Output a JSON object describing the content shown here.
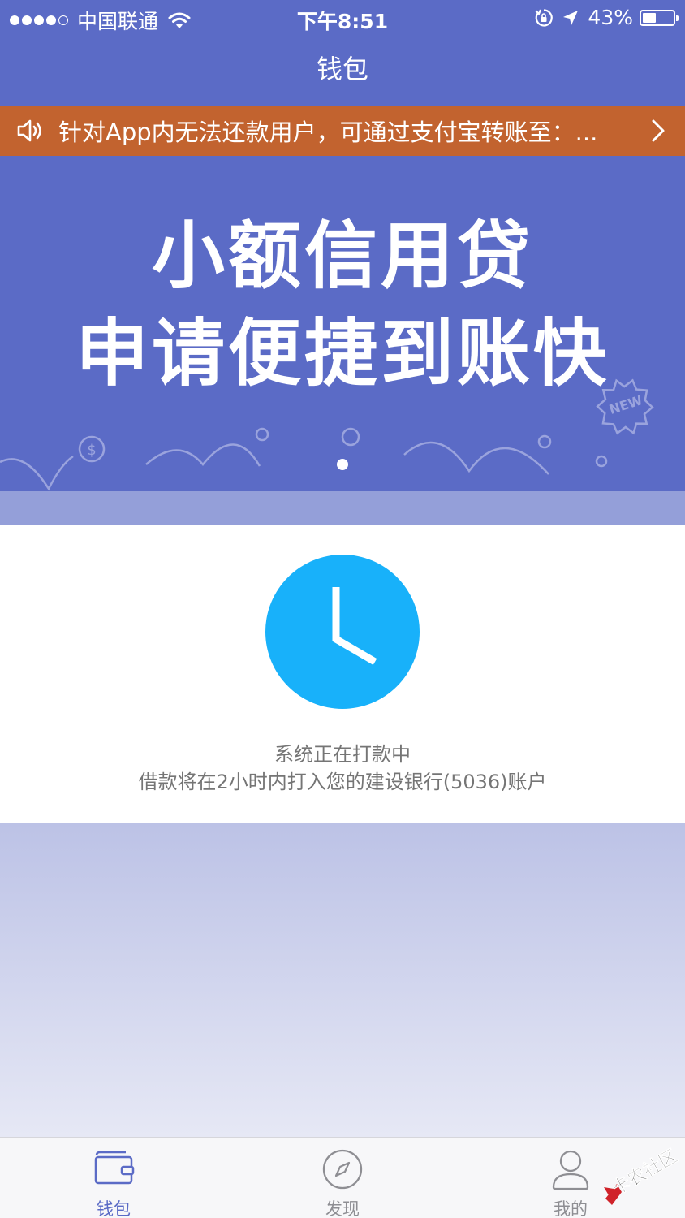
{
  "status_bar": {
    "carrier": "中国联通",
    "time": "下午8:51",
    "battery_pct": "43%",
    "battery_level": 0.43
  },
  "nav": {
    "title": "钱包"
  },
  "notice": {
    "text": "针对App内无法还款用户，可通过支付宝转账至：..."
  },
  "banner": {
    "line1": "小额信用贷",
    "line2": "申请便捷到账快",
    "badge": "NEW",
    "page_count": 1,
    "active_page": 1
  },
  "loan_status": {
    "title": "系统正在打款中",
    "description": "借款将在2小时内打入您的建设银行(5036)账户"
  },
  "tabs": [
    {
      "label": "钱包",
      "icon": "wallet-icon",
      "active": true
    },
    {
      "label": "发现",
      "icon": "compass-icon",
      "active": false
    },
    {
      "label": "我的",
      "icon": "user-icon",
      "active": false
    }
  ],
  "watermark": {
    "text": "卡农社区"
  },
  "colors": {
    "primary": "#5b6bc6",
    "notice": "#c2632f",
    "clock": "#18b1fa",
    "text_gray": "#757575",
    "tab_inactive": "#8e8e93"
  }
}
